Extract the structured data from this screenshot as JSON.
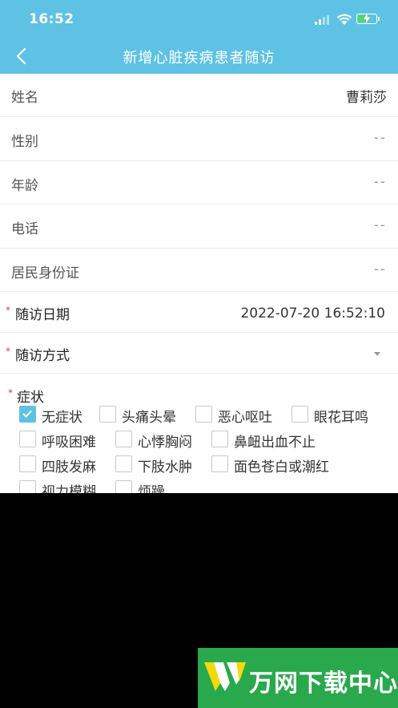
{
  "status_bar": {
    "time": "16:52"
  },
  "nav": {
    "title": "新增心脏疾病患者随访"
  },
  "fields": [
    {
      "label": "姓名",
      "value": "曹莉莎"
    },
    {
      "label": "性别",
      "value": "--"
    },
    {
      "label": "年龄",
      "value": "--"
    },
    {
      "label": "电话",
      "value": "--"
    },
    {
      "label": "居民身份证",
      "value": "--"
    }
  ],
  "visit_date": {
    "label": "随访日期",
    "value": "2022-07-20 16:52:10",
    "required_mark": "*"
  },
  "visit_method": {
    "label": "随访方式",
    "value": "",
    "required_mark": "*"
  },
  "symptoms": {
    "label": "症状",
    "required_mark": "*",
    "options": [
      {
        "label": "无症状",
        "checked": true
      },
      {
        "label": "头痛头晕",
        "checked": false
      },
      {
        "label": "恶心呕吐",
        "checked": false
      },
      {
        "label": "眼花耳鸣",
        "checked": false
      },
      {
        "label": "呼吸困难",
        "checked": false
      },
      {
        "label": "心悸胸闷",
        "checked": false
      },
      {
        "label": "鼻衄出血不止",
        "checked": false
      },
      {
        "label": "四肢发麻",
        "checked": false
      },
      {
        "label": "下肢水肿",
        "checked": false
      },
      {
        "label": "面色苍白或潮红",
        "checked": false
      },
      {
        "label": "视力模糊",
        "checked": false
      },
      {
        "label": "烦躁",
        "checked": false
      }
    ]
  },
  "watermark": {
    "text": "万网下载中心"
  },
  "colors": {
    "header": "#5ec2e4",
    "checkbox_checked": "#5ec2e4",
    "required": "#e04040",
    "watermark": "#29a84c"
  }
}
